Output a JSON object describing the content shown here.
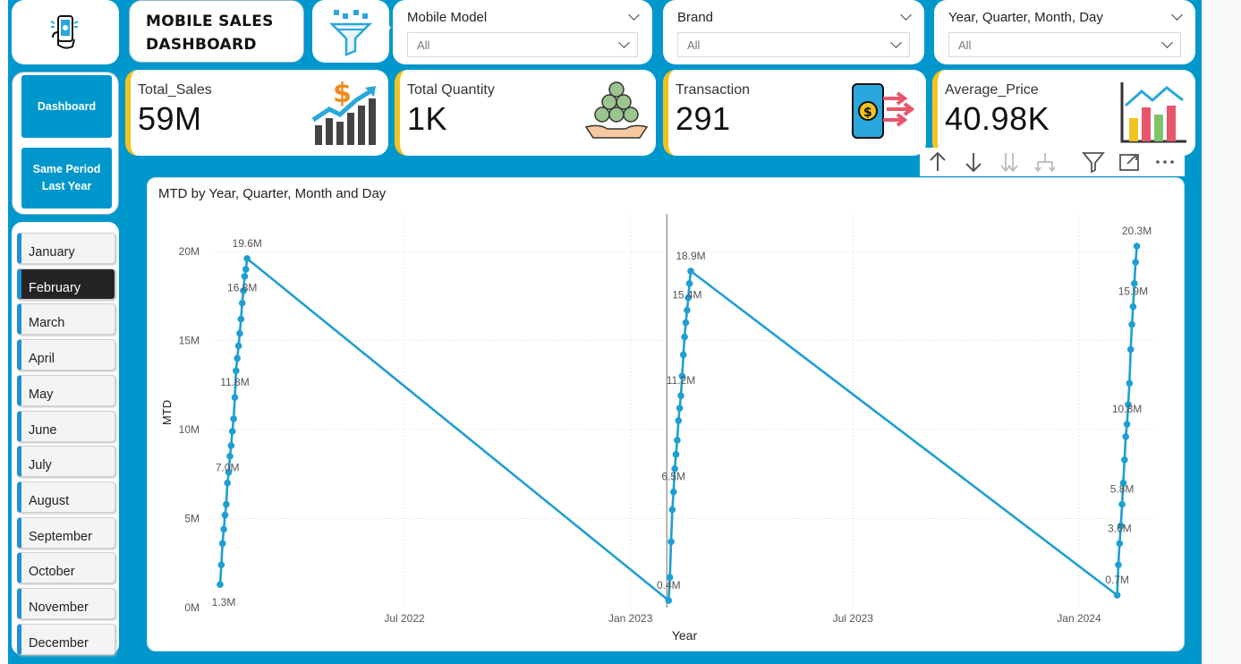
{
  "header": {
    "title_line1": "MOBILE SALES",
    "title_line2": "DASHBOARD",
    "logo_icon": "phone-hand-icon",
    "filter_icon": "funnel-icon"
  },
  "slicers": [
    {
      "label": "Mobile Model",
      "value": "All"
    },
    {
      "label": "Brand",
      "value": "All"
    },
    {
      "label": "Year, Quarter, Month, Day",
      "value": "All"
    }
  ],
  "nav": {
    "dashboard": "Dashboard",
    "same_period_line1": "Same Period",
    "same_period_line2": "Last Year"
  },
  "kpis": [
    {
      "label": "Total_Sales",
      "value": "59M",
      "icon": "money-growth-icon"
    },
    {
      "label": "Total Quantity",
      "value": "1K",
      "icon": "coins-hand-icon"
    },
    {
      "label": "Transaction",
      "value": "291",
      "icon": "mobile-payment-icon"
    },
    {
      "label": "Average_Price",
      "value": "40.98K",
      "icon": "bar-chart-icon"
    }
  ],
  "months": [
    "January",
    "February",
    "March",
    "April",
    "May",
    "June",
    "July",
    "August",
    "September",
    "October",
    "November",
    "December"
  ],
  "selected_month": "February",
  "toolbar": [
    "drill-up-icon",
    "drill-down-icon",
    "expand-all-icon",
    "expand-hierarchy-icon",
    "filter-icon",
    "focus-mode-icon",
    "more-options-icon"
  ],
  "colors": {
    "accent": "#0097cc",
    "kpi_bar": "#f2c320",
    "line": "#1e9fd2",
    "selected": "#252423"
  },
  "chart_data": {
    "type": "line",
    "title": "MTD by Year, Quarter, Month and Day",
    "xlabel": "Year",
    "ylabel": "MTD",
    "y_ticks": [
      "0M",
      "5M",
      "10M",
      "15M",
      "20M"
    ],
    "x_ticks": [
      "Jul 2022",
      "Jan 2023",
      "Jul 2023",
      "Jan 2024"
    ],
    "ylim": [
      0,
      22
    ],
    "grid": true,
    "series": [
      {
        "points": [
          {
            "x": "2022-02-01",
            "y": 1.3
          },
          {
            "x": "2022-02-02",
            "y": 2.4
          },
          {
            "x": "2022-02-03",
            "y": 3.6
          },
          {
            "x": "2022-02-04",
            "y": 4.4
          },
          {
            "x": "2022-02-05",
            "y": 5.2
          },
          {
            "x": "2022-02-06",
            "y": 5.8
          },
          {
            "x": "2022-02-07",
            "y": 7.0
          },
          {
            "x": "2022-02-08",
            "y": 7.6
          },
          {
            "x": "2022-02-09",
            "y": 8.5
          },
          {
            "x": "2022-02-10",
            "y": 9.1
          },
          {
            "x": "2022-02-11",
            "y": 9.9
          },
          {
            "x": "2022-02-12",
            "y": 10.6
          },
          {
            "x": "2022-02-13",
            "y": 11.8
          },
          {
            "x": "2022-02-14",
            "y": 13.3
          },
          {
            "x": "2022-02-15",
            "y": 14.0
          },
          {
            "x": "2022-02-16",
            "y": 14.7
          },
          {
            "x": "2022-02-17",
            "y": 15.4
          },
          {
            "x": "2022-02-18",
            "y": 16.2
          },
          {
            "x": "2022-02-19",
            "y": 17.1
          },
          {
            "x": "2022-02-20",
            "y": 17.8
          },
          {
            "x": "2022-02-21",
            "y": 18.6
          },
          {
            "x": "2022-02-22",
            "y": 19.0
          },
          {
            "x": "2022-02-23",
            "y": 19.6
          },
          {
            "x": "2023-02-01",
            "y": 0.4
          },
          {
            "x": "2023-02-02",
            "y": 1.7
          },
          {
            "x": "2023-02-03",
            "y": 3.7
          },
          {
            "x": "2023-02-04",
            "y": 5.5
          },
          {
            "x": "2023-02-05",
            "y": 6.5
          },
          {
            "x": "2023-02-06",
            "y": 7.8
          },
          {
            "x": "2023-02-07",
            "y": 8.6
          },
          {
            "x": "2023-02-08",
            "y": 9.4
          },
          {
            "x": "2023-02-09",
            "y": 10.5
          },
          {
            "x": "2023-02-10",
            "y": 11.2
          },
          {
            "x": "2023-02-11",
            "y": 11.9
          },
          {
            "x": "2023-02-12",
            "y": 13.0
          },
          {
            "x": "2023-02-13",
            "y": 14.2
          },
          {
            "x": "2023-02-14",
            "y": 15.2
          },
          {
            "x": "2023-02-15",
            "y": 16.0
          },
          {
            "x": "2023-02-16",
            "y": 16.7
          },
          {
            "x": "2023-02-17",
            "y": 17.4
          },
          {
            "x": "2023-02-18",
            "y": 18.2
          },
          {
            "x": "2023-02-19",
            "y": 18.9
          },
          {
            "x": "2024-02-01",
            "y": 0.7
          },
          {
            "x": "2024-02-02",
            "y": 2.4
          },
          {
            "x": "2024-02-03",
            "y": 3.6
          },
          {
            "x": "2024-02-04",
            "y": 4.6
          },
          {
            "x": "2024-02-05",
            "y": 5.8
          },
          {
            "x": "2024-02-06",
            "y": 7.0
          },
          {
            "x": "2024-02-07",
            "y": 8.3
          },
          {
            "x": "2024-02-08",
            "y": 9.6
          },
          {
            "x": "2024-02-09",
            "y": 10.3
          },
          {
            "x": "2024-02-10",
            "y": 11.4
          },
          {
            "x": "2024-02-11",
            "y": 12.6
          },
          {
            "x": "2024-02-12",
            "y": 14.5
          },
          {
            "x": "2024-02-13",
            "y": 15.9
          },
          {
            "x": "2024-02-14",
            "y": 16.9
          },
          {
            "x": "2024-02-15",
            "y": 18.2
          },
          {
            "x": "2024-02-16",
            "y": 19.4
          },
          {
            "x": "2024-02-17",
            "y": 20.3
          }
        ]
      }
    ],
    "data_labels": [
      {
        "x": "2022-02-01",
        "y": 1.3,
        "text": "1.3M"
      },
      {
        "x": "2022-02-07",
        "y": 7.0,
        "text": "7.0M"
      },
      {
        "x": "2022-02-13",
        "y": 11.8,
        "text": "11.8M"
      },
      {
        "x": "2022-02-19",
        "y": 17.1,
        "text": "16.8M"
      },
      {
        "x": "2022-02-23",
        "y": 19.6,
        "text": "19.6M"
      },
      {
        "x": "2023-02-01",
        "y": 0.4,
        "text": "0.4M"
      },
      {
        "x": "2023-02-05",
        "y": 6.5,
        "text": "6.5M"
      },
      {
        "x": "2023-02-11",
        "y": 11.9,
        "text": "11.2M"
      },
      {
        "x": "2023-02-16",
        "y": 16.7,
        "text": "15.4M"
      },
      {
        "x": "2023-02-19",
        "y": 18.9,
        "text": "18.9M"
      },
      {
        "x": "2024-02-01",
        "y": 0.7,
        "text": "0.7M"
      },
      {
        "x": "2024-02-03",
        "y": 3.6,
        "text": "3.6M"
      },
      {
        "x": "2024-02-05",
        "y": 5.8,
        "text": "5.8M"
      },
      {
        "x": "2024-02-09",
        "y": 10.3,
        "text": "10.8M"
      },
      {
        "x": "2024-02-14",
        "y": 16.9,
        "text": "15.9M"
      },
      {
        "x": "2024-02-17",
        "y": 20.3,
        "text": "20.3M"
      }
    ],
    "reference_line_x": "2023-02-01"
  }
}
